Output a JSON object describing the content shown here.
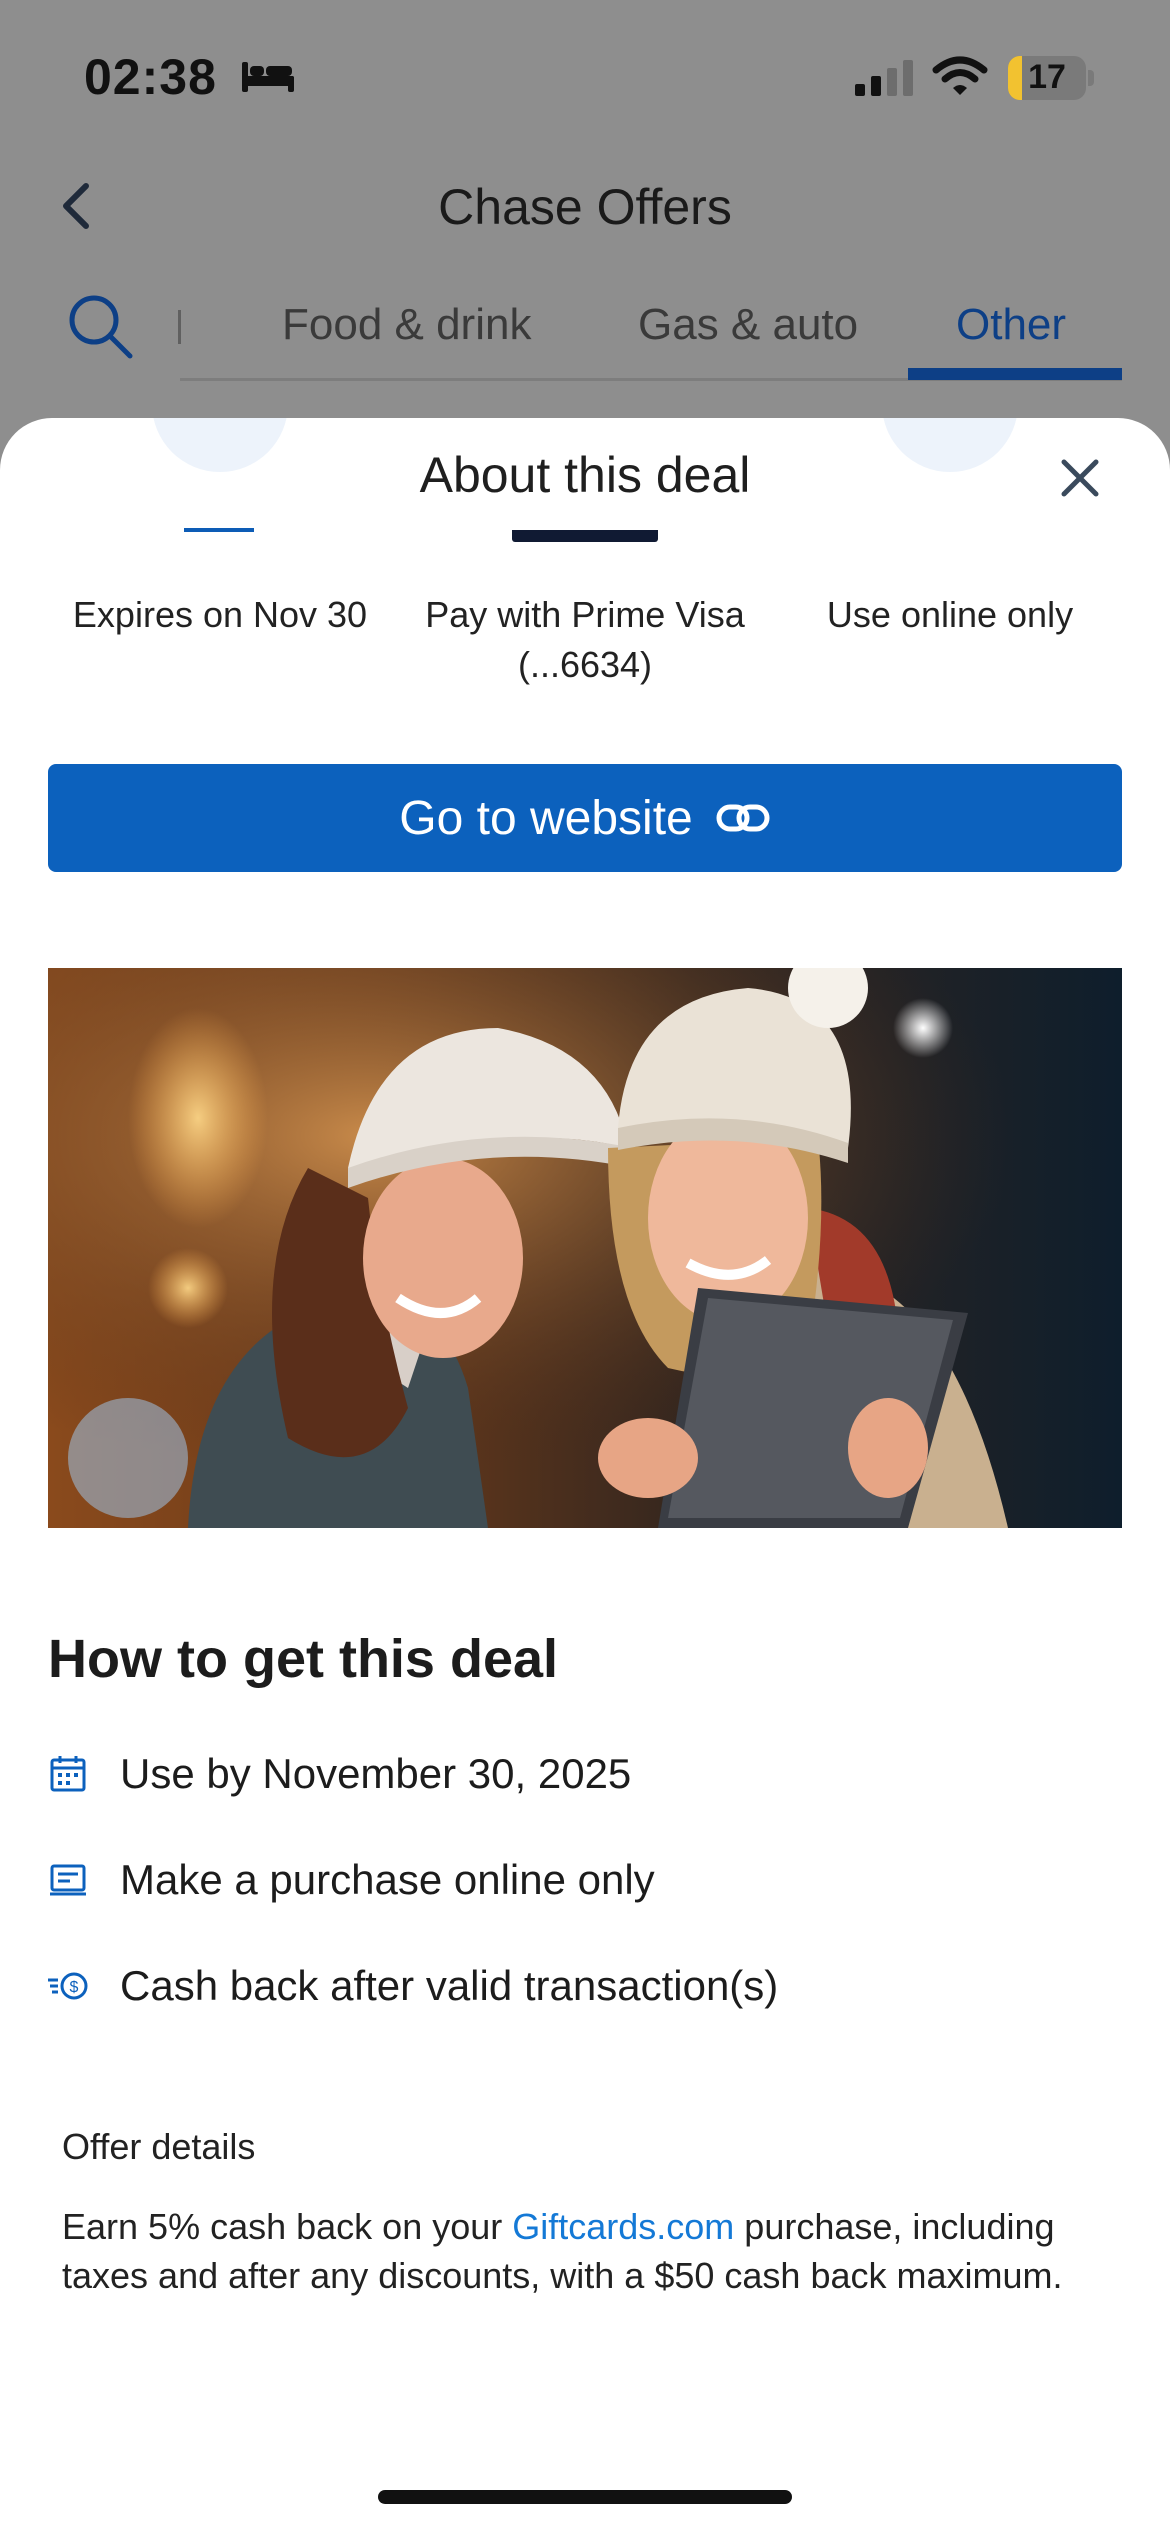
{
  "status_bar": {
    "time": "02:38",
    "battery": "17"
  },
  "header": {
    "title": "Chase Offers"
  },
  "tabs": [
    {
      "label": "Food & drink"
    },
    {
      "label": "Gas & auto"
    },
    {
      "label": "Other",
      "active": true
    }
  ],
  "sheet": {
    "title": "About this deal",
    "features": [
      {
        "label": "Expires on Nov 30"
      },
      {
        "label": "Pay with Prime Visa\n(...6634)"
      },
      {
        "label": "Use online only"
      }
    ],
    "cta_label": "Go to website",
    "how_title": "How to get this deal",
    "steps": [
      {
        "icon": "calendar-icon",
        "text": "Use by November 30, 2025"
      },
      {
        "icon": "online-purchase-icon",
        "text": "Make a purchase online only"
      },
      {
        "icon": "cash-back-icon",
        "text": "Cash back after valid transaction(s)"
      }
    ],
    "offer_details_label": "Offer details",
    "offer_details": {
      "prefix": "Earn 5% cash back on your ",
      "link": "Giftcards.com",
      "suffix": " purchase, including taxes and after any discounts, with a $50 cash back maximum."
    }
  },
  "colors": {
    "primary": "#0c61bd",
    "active_tab": "#0d3f86",
    "link": "#1479d6",
    "overlay": "#8e8e8e"
  }
}
